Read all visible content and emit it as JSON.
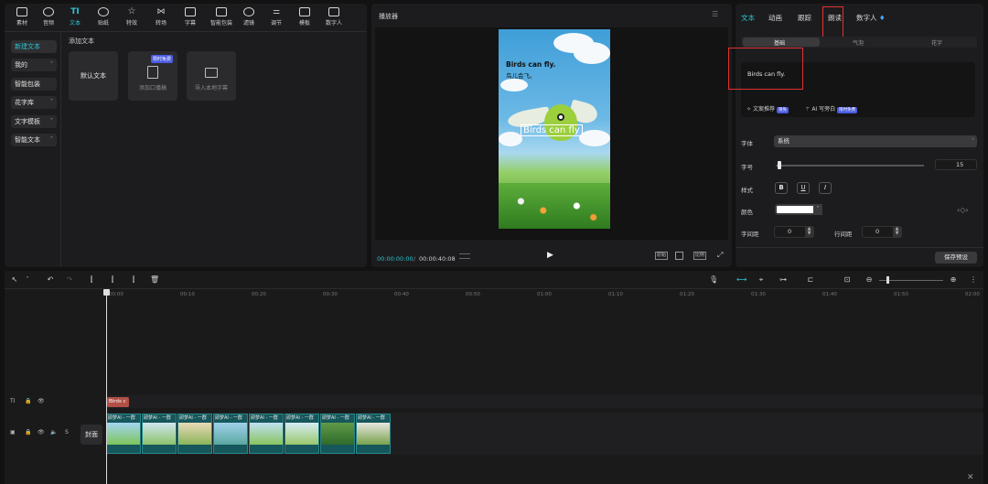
{
  "toolbar_tabs": [
    {
      "label": "素材",
      "icon": "media-icon"
    },
    {
      "label": "音频",
      "icon": "audio-icon"
    },
    {
      "label": "文本",
      "icon": "text-icon"
    },
    {
      "label": "贴纸",
      "icon": "sticker-icon"
    },
    {
      "label": "特效",
      "icon": "effects-icon"
    },
    {
      "label": "转场",
      "icon": "transition-icon"
    },
    {
      "label": "字幕",
      "icon": "subtitle-icon"
    },
    {
      "label": "智能包装",
      "icon": "smart-pack-icon"
    },
    {
      "label": "滤镜",
      "icon": "filter-icon"
    },
    {
      "label": "调节",
      "icon": "adjust-icon"
    },
    {
      "label": "模板",
      "icon": "template-icon"
    },
    {
      "label": "数字人",
      "icon": "digital-human-icon"
    }
  ],
  "sidebar": {
    "items": [
      {
        "label": "新建文本",
        "active": true
      },
      {
        "label": "我的",
        "chevron": "˅"
      },
      {
        "label": "智能包装"
      },
      {
        "label": "花字库",
        "chevron": "˅"
      },
      {
        "label": "文字模板",
        "chevron": "˅"
      },
      {
        "label": "智能文本",
        "chevron": "˅"
      }
    ]
  },
  "add_text": {
    "title": "添加文本",
    "default_card": "默认文本",
    "ai_card": {
      "label": "添加口播稿",
      "badge": "限时免费"
    },
    "import_card": "导入本地字幕"
  },
  "player": {
    "title": "播放器",
    "menu": "☰",
    "caption_en": "Birds can fly.",
    "caption_zh": "鸟儿会飞。",
    "overlay_text": "Birds can fly",
    "time_current": "00:00:00:00",
    "time_separator": "/",
    "time_total": "00:00:40:08",
    "play": "▶",
    "buttons": [
      "原始",
      "比例"
    ]
  },
  "inspector": {
    "tabs": [
      "文本",
      "动画",
      "跟踪",
      "朗读",
      "数字人"
    ],
    "subtabs": [
      "基础",
      "气泡",
      "花字"
    ],
    "text_value": "Birds can fly.",
    "copy_tools": [
      {
        "label": "文案推荐",
        "badge": "限免"
      },
      {
        "label": "AI 写旁白",
        "badge": "限时免费"
      }
    ],
    "font_label": "字体",
    "font_value": "系统",
    "size_label": "字号",
    "size_value": "15",
    "style_label": "样式",
    "style_buttons": [
      "B",
      "U",
      "I"
    ],
    "color_label": "颜色",
    "letter_spacing_label": "字间距",
    "letter_spacing_value": "0",
    "line_spacing_label": "行间距",
    "line_spacing_value": "0",
    "save_preset": "保存预设",
    "highlight_color": "#e13232",
    "accent_color": "#28c7d3"
  },
  "timeline": {
    "ticks": [
      "00:00",
      "00:10",
      "00:20",
      "00:30",
      "00:40",
      "00:50",
      "01:00",
      "01:10",
      "01:20",
      "01:30",
      "01:40",
      "01:50",
      "02:00"
    ],
    "text_clip": "Birds c",
    "cover_label": "封面",
    "clip_label": "即梦AI - 一群",
    "clip_count": 8
  }
}
